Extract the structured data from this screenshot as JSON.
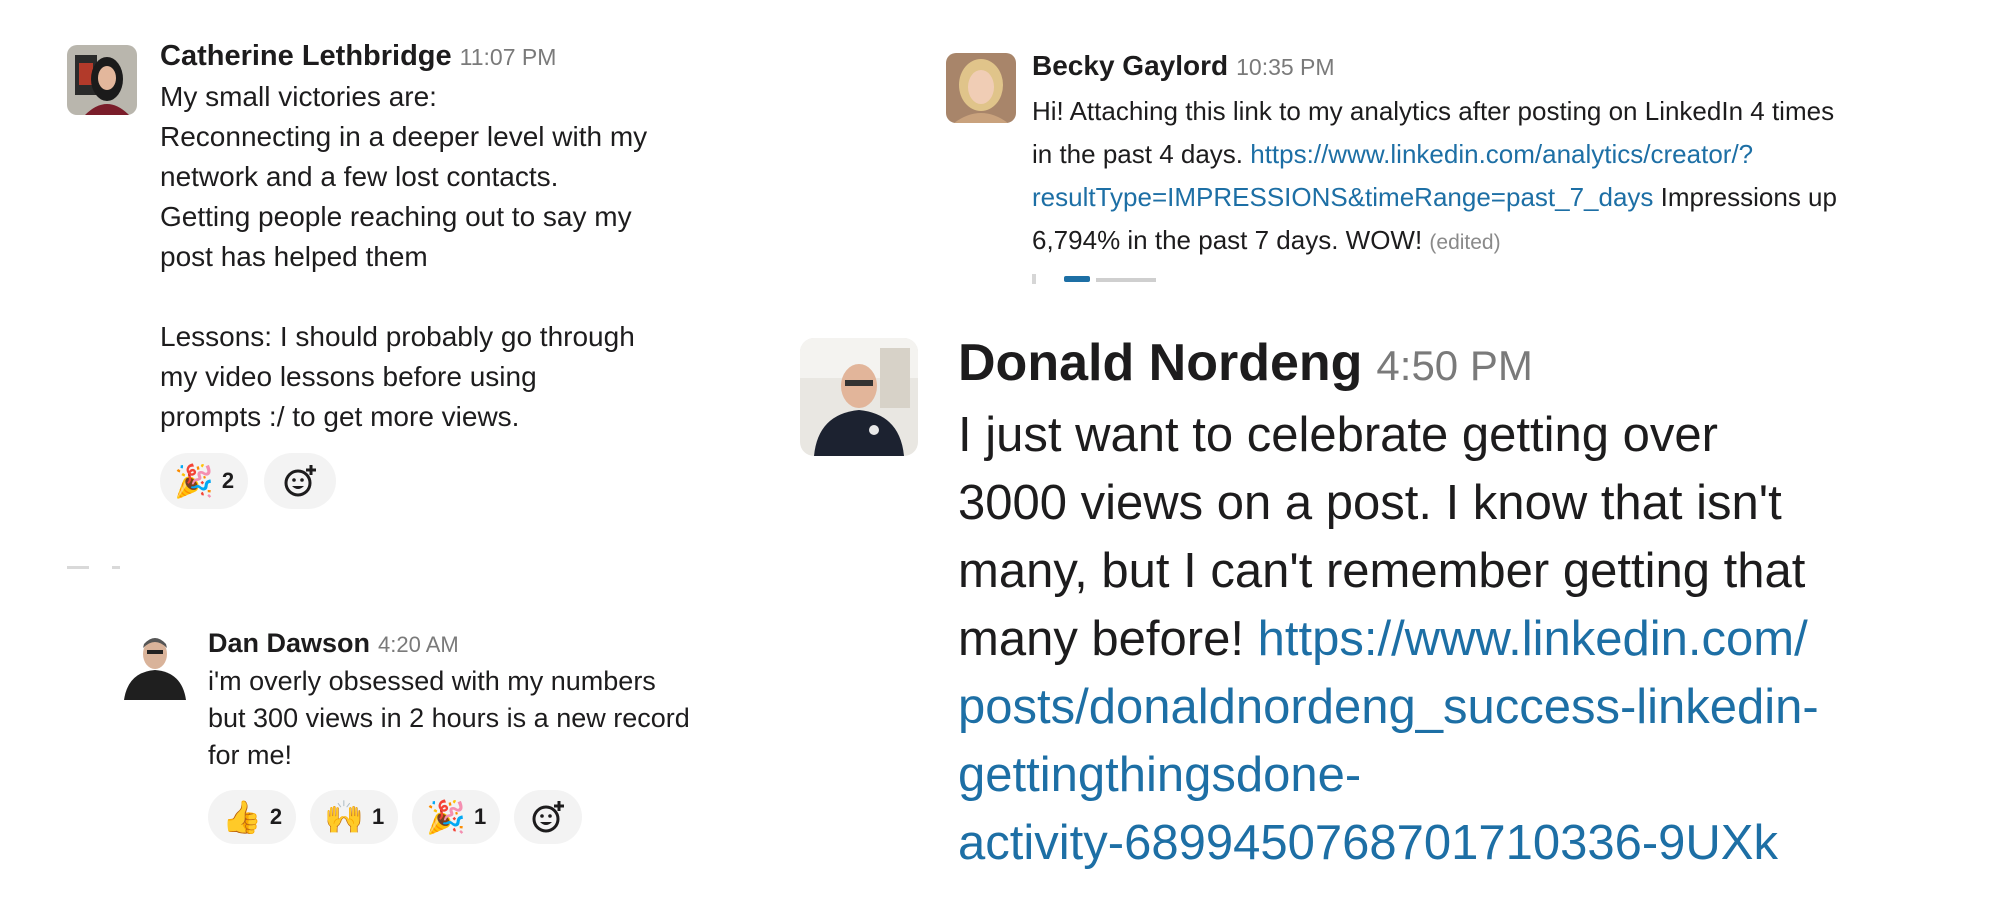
{
  "messages": [
    {
      "author": "Catherine Lethbridge",
      "time": "11:07 PM",
      "body": "My small victories are:\nReconnecting in a deeper level with my\nnetwork and a few lost contacts.\nGetting people reaching out to say my\npost has helped them\n\nLessons: I should probably go through\nmy video lessons before using\nprompts :/ to get more views.",
      "reactions": [
        {
          "emoji": "🎉",
          "count": "2"
        }
      ]
    },
    {
      "author": "Becky Gaylord",
      "time": "10:35 PM",
      "body_before": "Hi! Attaching this link to my analytics after posting on LinkedIn 4 times\nin the past 4 days. ",
      "link": "https://www.linkedin.com/analytics/creator/?\nresultType=IMPRESSIONS&timeRange=past_7_days",
      "body_after": " Impressions up\n6,794% in the past 7 days. WOW! ",
      "edited": "(edited)"
    },
    {
      "author": "Dan Dawson",
      "time": "4:20 AM",
      "body": "i'm overly obsessed with my numbers\nbut 300 views in 2 hours is a new record\nfor me!",
      "reactions": [
        {
          "emoji": "👍",
          "count": "2"
        },
        {
          "emoji": "🙌",
          "count": "1"
        },
        {
          "emoji": "🎉",
          "count": "1"
        }
      ]
    },
    {
      "author": "Donald Nordeng",
      "time": "4:50 PM",
      "body": "I just want to celebrate getting over\n3000 views on a post. I know that isn't\nmany, but I can't remember getting that\nmany before! ",
      "link": "https://www.linkedin.com/\nposts/donaldnordeng_success-linkedin-\ngettingthingsdone-\nactivity-6899450768701710336-9UXk"
    }
  ],
  "icons": {
    "add_reaction": "add-reaction-icon"
  },
  "colors": {
    "link": "#1d6fa5",
    "pill_bg": "#f3f3f3",
    "time": "#7a7a7a"
  }
}
